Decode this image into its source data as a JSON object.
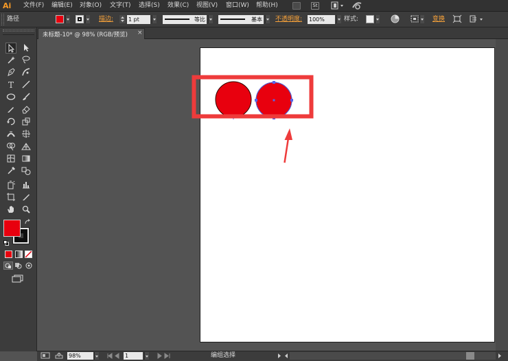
{
  "app": {
    "logo": "Ai"
  },
  "menu": {
    "items": [
      {
        "label": "文件(F)"
      },
      {
        "label": "编辑(E)"
      },
      {
        "label": "对象(O)"
      },
      {
        "label": "文字(T)"
      },
      {
        "label": "选择(S)"
      },
      {
        "label": "效果(C)"
      },
      {
        "label": "视图(V)"
      },
      {
        "label": "窗口(W)"
      },
      {
        "label": "帮助(H)"
      }
    ],
    "st_label": "St"
  },
  "control_bar": {
    "object_label": "路径",
    "fill_color": "#e8000e",
    "stroke_label": "描边:",
    "stroke_weight": "1 pt",
    "profile_label": "等比",
    "brush_label": "基本",
    "opacity_label": "不透明度:",
    "opacity_value": "100%",
    "style_label": "样式:",
    "transform_label": "变换"
  },
  "document": {
    "tab_title": "未标题-10* @ 98% (RGB/预览)",
    "close_glyph": "×"
  },
  "canvas": {
    "circle_fill": "#e8000e",
    "highlight_color": "#ee3b3b",
    "selection_color": "#5866e8"
  },
  "toolbox": {
    "fill_color": "#e8000e",
    "stroke_color": "#111111"
  },
  "status_bar": {
    "zoom": "98%",
    "page": "1",
    "status_text": "编组选择"
  }
}
